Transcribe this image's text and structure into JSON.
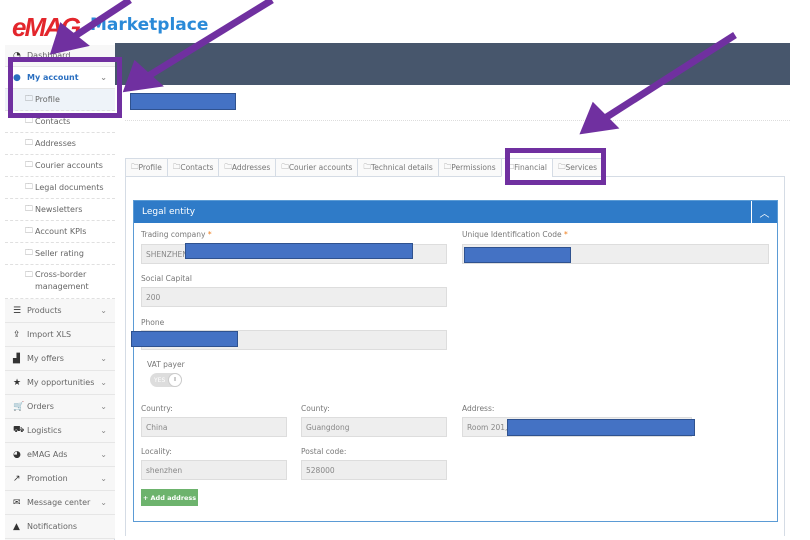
{
  "logo": {
    "brand": "eMAG",
    "product": "Marketplace"
  },
  "sidebar": {
    "dashboard": "Dashboard",
    "my_account": "My account",
    "sub_items": [
      "Profile",
      "Contacts",
      "Addresses",
      "Courier accounts",
      "Legal documents",
      "Newsletters",
      "Account KPIs",
      "Seller rating",
      "Cross-border management"
    ],
    "items": [
      {
        "label": "Products",
        "icon": "list-icon",
        "chev": true
      },
      {
        "label": "Import XLS",
        "icon": "upload-icon",
        "chev": false
      },
      {
        "label": "My offers",
        "icon": "chart-icon",
        "chev": true
      },
      {
        "label": "My opportunities",
        "icon": "star-icon",
        "chev": true
      },
      {
        "label": "Orders",
        "icon": "cart-icon",
        "chev": true
      },
      {
        "label": "Logistics",
        "icon": "truck-icon",
        "chev": true
      },
      {
        "label": "eMAG Ads",
        "icon": "pie-icon",
        "chev": true
      },
      {
        "label": "Promotion",
        "icon": "line-chart-icon",
        "chev": true
      },
      {
        "label": "Message center",
        "icon": "envelope-icon",
        "chev": true
      },
      {
        "label": "Notifications",
        "icon": "bell-icon",
        "chev": false
      }
    ]
  },
  "tabs": [
    "Profile",
    "Contacts",
    "Addresses",
    "Courier accounts",
    "Technical details",
    "Permissions",
    "Financial",
    "Services"
  ],
  "active_tab": "Financial",
  "panel": {
    "title": "Legal entity",
    "trading_company_label": "Trading company",
    "trading_company_value": "SHENZHEN",
    "uic_label": "Unique Identification Code",
    "social_capital_label": "Social Capital",
    "social_capital_value": "200",
    "phone_label": "Phone",
    "vat_label": "VAT payer",
    "vat_value": "YES",
    "country_label": "Country:",
    "country_value": "China",
    "county_label": "County:",
    "county_value": "Guangdong",
    "address_label": "Address:",
    "address_value": "Room 201,",
    "locality_label": "Locality:",
    "locality_value": "shenzhen",
    "postal_label": "Postal code:",
    "postal_value": "528000",
    "add_address": "+ Add address",
    "required": "*"
  },
  "colors": {
    "annotation": "#7030a0",
    "redaction": "#4472c4",
    "header": "#47566c",
    "panel": "#2f7bc8"
  }
}
